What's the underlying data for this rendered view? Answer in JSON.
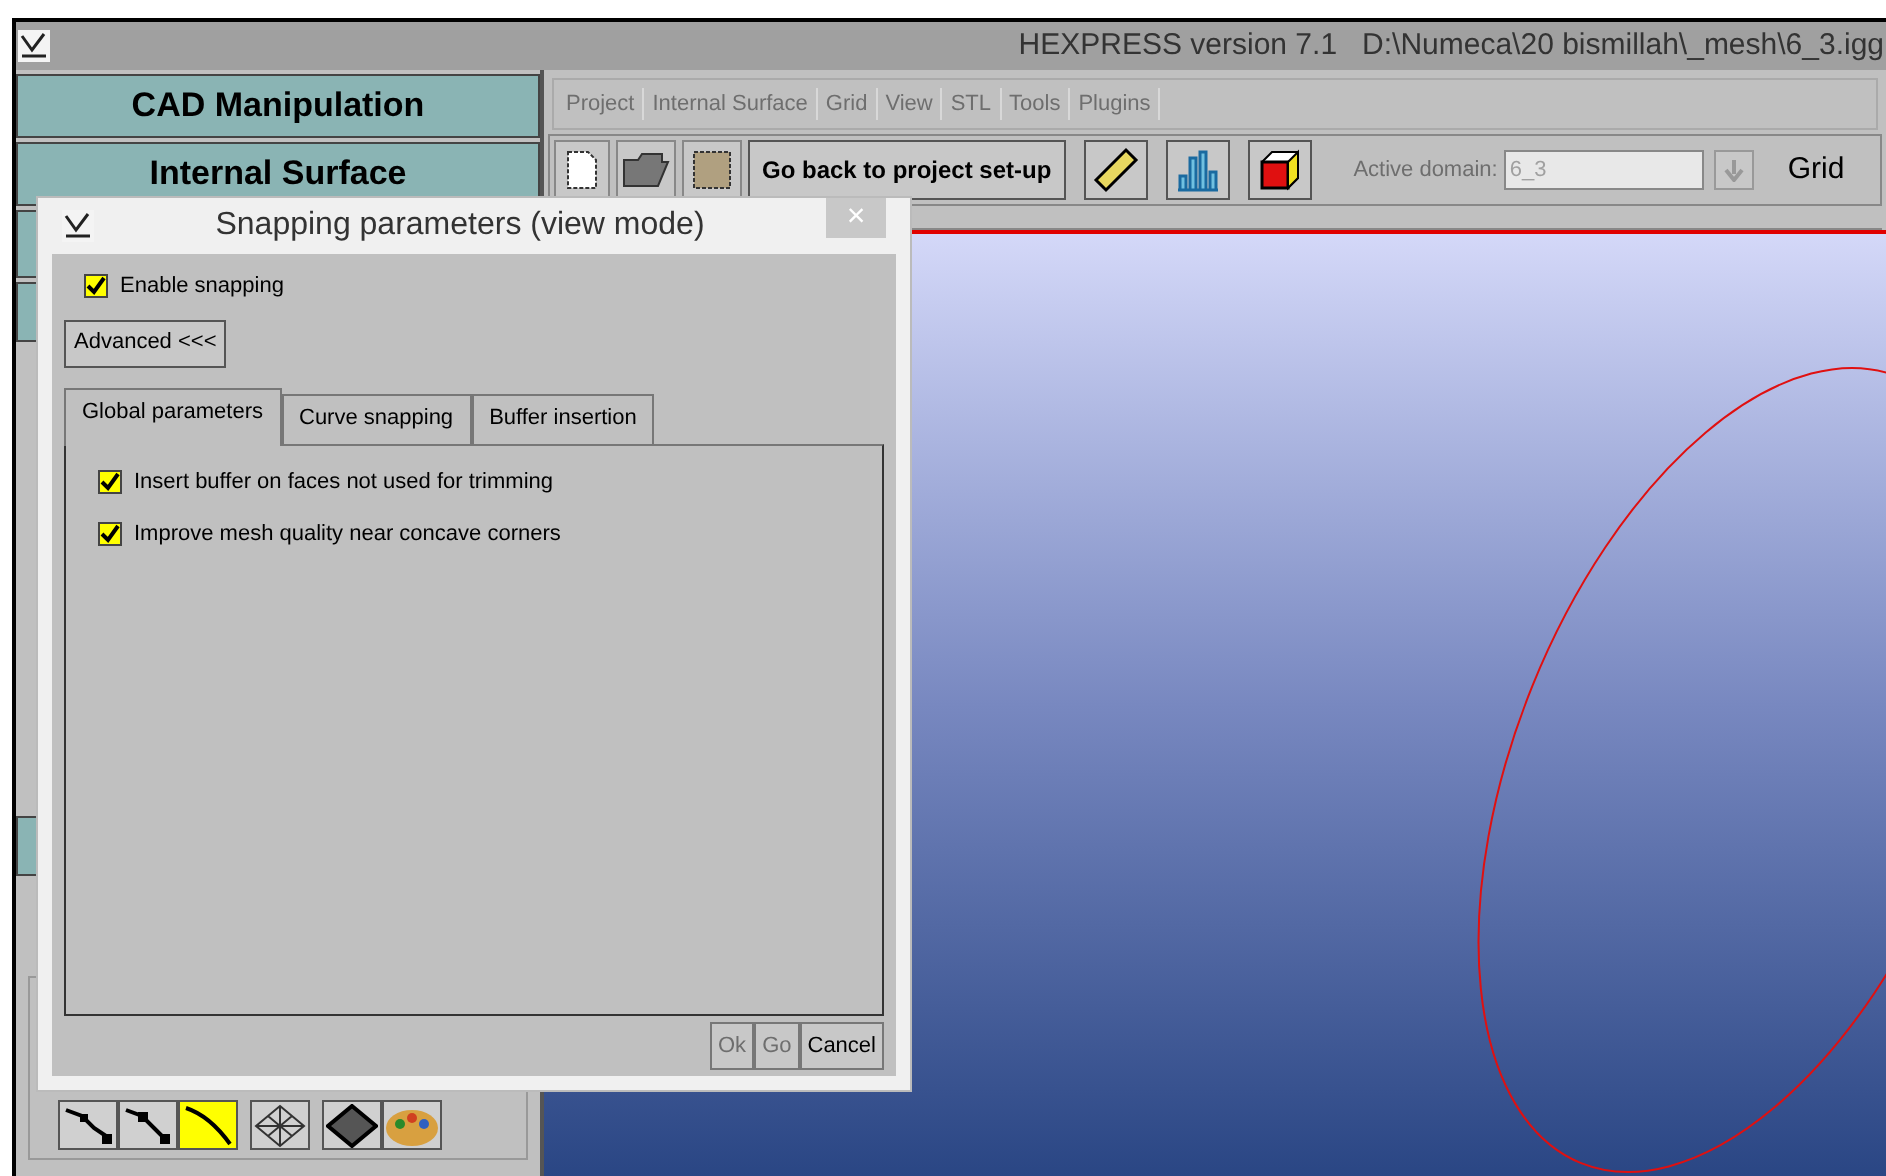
{
  "window": {
    "title": "HEXPRESS version 7.1   D:\\Numeca\\20 bismillah\\_mesh\\6_3.igg"
  },
  "side_panel": {
    "buttons": [
      {
        "label": "CAD Manipulation"
      },
      {
        "label": "Internal Surface"
      }
    ],
    "bottom_tools": [
      {
        "kind": "numbered",
        "selected": false
      },
      {
        "kind": "polyline",
        "selected": false
      },
      {
        "kind": "curve",
        "selected": true
      },
      {
        "kind": "grid",
        "selected": false
      },
      {
        "kind": "diamond",
        "selected": false
      },
      {
        "kind": "palette",
        "selected": false
      }
    ]
  },
  "menu": [
    {
      "label": "Project",
      "disabled": true
    },
    {
      "label": "Internal Surface",
      "disabled": true
    },
    {
      "label": "Grid",
      "disabled": true
    },
    {
      "label": "View",
      "disabled": true
    },
    {
      "label": "STL",
      "disabled": true
    },
    {
      "label": "Tools",
      "disabled": true
    },
    {
      "label": "Plugins",
      "disabled": true
    }
  ],
  "toolbar": {
    "back_button": "Go back to project set-up",
    "domain_label": "Active domain:",
    "domain_value": "6_3",
    "grid_label": "Grid"
  },
  "dialog": {
    "title": "Snapping parameters (view mode)",
    "close": "×",
    "enable": {
      "label": "Enable snapping",
      "checked": true
    },
    "advanced_button": "Advanced <<<",
    "tabs": [
      {
        "label": "Global parameters",
        "selected": true
      },
      {
        "label": "Curve snapping",
        "selected": false
      },
      {
        "label": "Buffer insertion",
        "selected": false
      }
    ],
    "options": [
      {
        "label": "Insert buffer on faces not used for trimming",
        "checked": true
      },
      {
        "label": "Improve mesh quality near concave corners",
        "checked": true
      }
    ],
    "buttons": [
      {
        "label": "Ok",
        "disabled": true
      },
      {
        "label": "Go",
        "disabled": true
      },
      {
        "label": "Cancel",
        "disabled": false
      }
    ]
  }
}
